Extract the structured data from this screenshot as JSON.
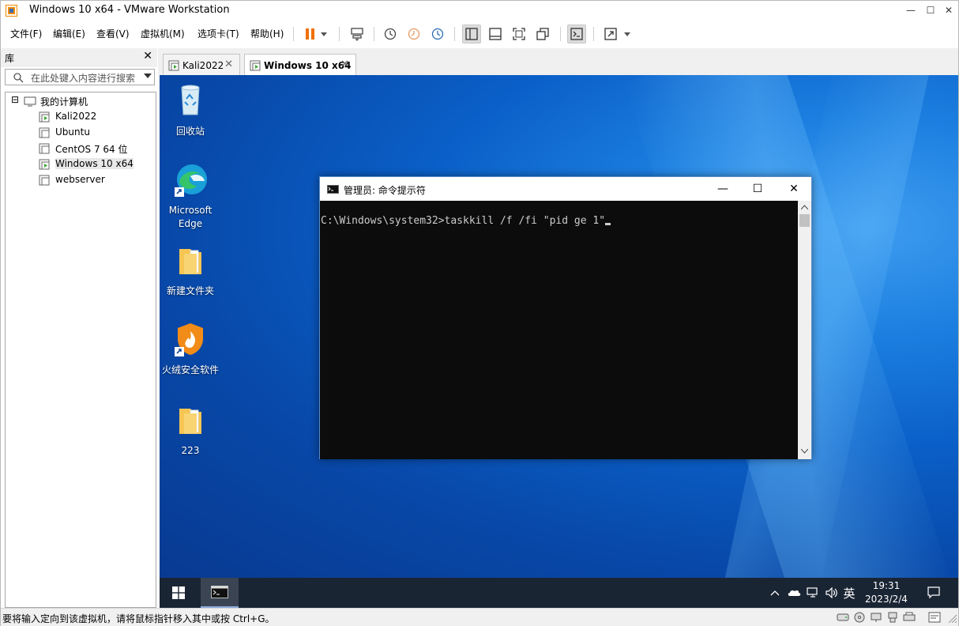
{
  "window": {
    "title": "Windows 10 x64 - VMware Workstation",
    "minimize_glyph": "—",
    "maximize_glyph": "☐",
    "close_glyph": "✕"
  },
  "menu": [
    "文件(F)",
    "编辑(E)",
    "查看(V)",
    "虚拟机(M)",
    "选项卡(T)",
    "帮助(H)"
  ],
  "library": {
    "title": "库",
    "close": "✕",
    "search_placeholder": "在此处键入内容进行搜索",
    "root": "我的计算机",
    "root_toggle": "⊟",
    "vms": [
      "Kali2022",
      "Ubuntu",
      "CentOS 7 64 位",
      "Windows 10 x64",
      "webserver"
    ],
    "selected_vm": "Windows 10 x64"
  },
  "tabs": [
    {
      "label": "Kali2022",
      "close": "✕",
      "active": false
    },
    {
      "label": "Windows 10 x64",
      "close": "✕",
      "active": true
    }
  ],
  "desktop": {
    "icons": [
      {
        "label": "回收站",
        "icon": "recycle-bin-icon"
      },
      {
        "label": "Microsoft Edge",
        "icon": "edge-icon"
      },
      {
        "label": "新建文件夹",
        "icon": "folder-icon"
      },
      {
        "label": "火绒安全软件",
        "icon": "huorong-icon"
      },
      {
        "label": "223",
        "icon": "folder-icon"
      }
    ]
  },
  "cmd": {
    "title": "管理员: 命令提示符",
    "prompt_line": "C:\\Windows\\system32>taskkill /f /fi \"pid ge 1\"",
    "minimize_glyph": "—",
    "maximize_glyph": "☐",
    "close_glyph": "✕"
  },
  "taskbar": {
    "tray_chevron": "^",
    "ime": "英",
    "time": "19:31",
    "date": "2023/2/4"
  },
  "statusbar": {
    "message": "要将输入定向到该虚拟机，请将鼠标指针移入其中或按 Ctrl+G。"
  },
  "colors": {
    "desktop_blue": "#0a5fc7",
    "taskbar": "#1a2534",
    "pause_orange": "#f07000",
    "cmd_background": "#0c0c0c"
  }
}
